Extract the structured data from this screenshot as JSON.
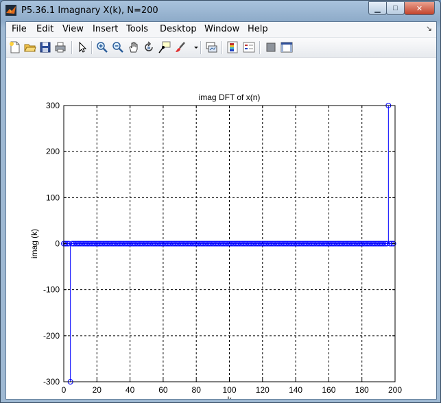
{
  "window": {
    "title": "P5.36.1 Imagnary X(k), N=200",
    "minimize_glyph": "▁",
    "maximize_glyph": "□",
    "close_glyph": "✕"
  },
  "menu": {
    "items": [
      "File",
      "Edit",
      "View",
      "Insert",
      "Tools",
      "Desktop",
      "Window",
      "Help"
    ],
    "dock_arrow": "↘"
  },
  "toolbar": {
    "buttons": [
      "new-figure",
      "open-file",
      "save-figure",
      "print-figure",
      "edit-plot",
      "zoom-in",
      "zoom-out",
      "pan",
      "rotate-3d",
      "data-cursor",
      "brush",
      "brush-dropdown",
      "link-plot",
      "insert-colorbar",
      "insert-legend",
      "hide-plot-tools",
      "show-plot-tools"
    ]
  },
  "chart_data": {
    "type": "stem",
    "title": "imag DFT of x(n)",
    "xlabel": "k",
    "ylabel": "imag (k)",
    "xlim": [
      0,
      200
    ],
    "ylim": [
      -300,
      300
    ],
    "xticks": [
      0,
      20,
      40,
      60,
      80,
      100,
      120,
      140,
      160,
      180,
      200
    ],
    "yticks": [
      -300,
      -200,
      -100,
      0,
      100,
      200,
      300
    ],
    "grid": "dashed",
    "color": "#0000ff",
    "n_points": 200,
    "nonzero_points": [
      {
        "k": 4,
        "value": -300
      },
      {
        "k": 196,
        "value": 300
      }
    ],
    "other_values": 0
  }
}
